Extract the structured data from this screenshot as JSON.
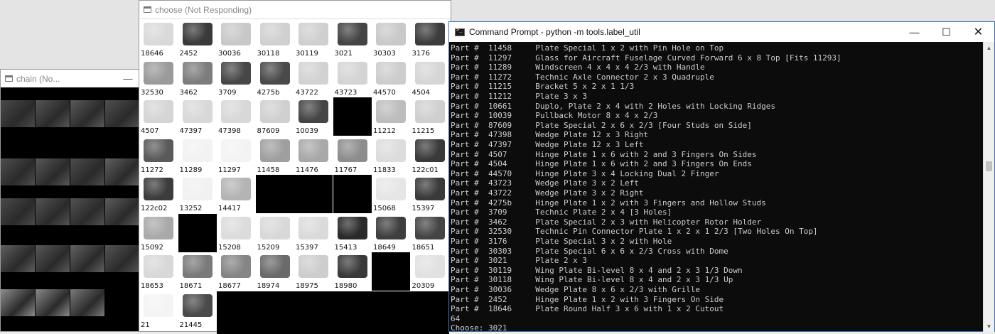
{
  "chain_window": {
    "title": "chain (No...",
    "minimize_glyph": "—",
    "thumbnails": [
      {
        "tone": "#4a4a4a"
      },
      {
        "tone": "#555"
      },
      {
        "tone": "#5a5a5a"
      },
      {
        "tone": "#505050"
      },
      {
        "tone": "#4e4e4e"
      },
      {
        "tone": "#585858"
      },
      {
        "tone": "#4c4c4c"
      },
      {
        "tone": "#606060"
      },
      {
        "tone": "#4a4a4a"
      },
      {
        "tone": "#545454"
      },
      {
        "tone": "#525252"
      },
      {
        "tone": "#5c5c5c"
      },
      {
        "tone": "#5f5f5f"
      },
      {
        "tone": "#585858"
      },
      {
        "tone": "#626262"
      },
      {
        "tone": "#545454"
      },
      {
        "tone": "#8e8e8e"
      },
      {
        "tone": "#8a8a8a"
      },
      {
        "tone": "#7a7a7a"
      }
    ]
  },
  "choose_window": {
    "title": "choose (Not Responding)",
    "parts": [
      {
        "label": "18646",
        "color": "#d9d9d9"
      },
      {
        "label": "2452",
        "color": "#3a3a3a"
      },
      {
        "label": "30036",
        "color": "#c8c8c8"
      },
      {
        "label": "30118",
        "color": "#d0d0d0"
      },
      {
        "label": "30119",
        "color": "#cfcfcf"
      },
      {
        "label": "3021",
        "color": "#444"
      },
      {
        "label": "30303",
        "color": "#c9c9c9"
      },
      {
        "label": "3176",
        "color": "#3c3c3c"
      },
      {
        "label": "32530",
        "color": "#9a9a9a"
      },
      {
        "label": "3462",
        "color": "#7d7d7d"
      },
      {
        "label": "3709",
        "color": "#474747"
      },
      {
        "label": "4275b",
        "color": "#4a4a4a"
      },
      {
        "label": "43722",
        "color": "#d2d2d2"
      },
      {
        "label": "43723",
        "color": "#d4d4d4"
      },
      {
        "label": "44570",
        "color": "#cdcdcd"
      },
      {
        "label": "4504",
        "color": "#d6d6d6"
      },
      {
        "label": "4507",
        "color": "#d5d5d5"
      },
      {
        "label": "47397",
        "color": "#d8d8d8"
      },
      {
        "label": "47398",
        "color": "#d8d8d8"
      },
      {
        "label": "87609",
        "color": "#d0d0d0"
      },
      {
        "label": "10039",
        "color": "#454545"
      },
      {
        "label": "",
        "color": "#000000"
      },
      {
        "label": "11212",
        "color": "#bdbdbd"
      },
      {
        "label": "11215",
        "color": "#cfcfcf"
      },
      {
        "label": "11272",
        "color": "#5a5a5a"
      },
      {
        "label": "11289",
        "color": "#f2f2f2"
      },
      {
        "label": "11297",
        "color": "#f3f3f3"
      },
      {
        "label": "11458",
        "color": "#9f9f9f"
      },
      {
        "label": "11476",
        "color": "#a8a8a8"
      },
      {
        "label": "11767",
        "color": "#8d8d8d"
      },
      {
        "label": "11833",
        "color": "#dcdcdc"
      },
      {
        "label": "122c01",
        "color": "#3a3a3a"
      },
      {
        "label": "122c02",
        "color": "#3c3c3c"
      },
      {
        "label": "13252",
        "color": "#f1f1f1"
      },
      {
        "label": "14417",
        "color": "#b4b4b4"
      },
      {
        "label": "",
        "color": "#000000"
      },
      {
        "label": "",
        "color": "#000000"
      },
      {
        "label": "",
        "color": "#000000"
      },
      {
        "label": "15068",
        "color": "#e6e6e6"
      },
      {
        "label": "15397",
        "color": "#3a3a3a"
      },
      {
        "label": "15092",
        "color": "#a9a9a9"
      },
      {
        "label": "",
        "color": "#000000"
      },
      {
        "label": "15208",
        "color": "#dcdcdc"
      },
      {
        "label": "15209",
        "color": "#d8d8d8"
      },
      {
        "label": "15397",
        "color": "#dadada"
      },
      {
        "label": "15413",
        "color": "#2a2a2a"
      },
      {
        "label": "18649",
        "color": "#3e3e3e"
      },
      {
        "label": "18651",
        "color": "#444"
      },
      {
        "label": "18653",
        "color": "#d8d8d8"
      },
      {
        "label": "18671",
        "color": "#7a7a7a"
      },
      {
        "label": "18677",
        "color": "#858585"
      },
      {
        "label": "18974",
        "color": "#6a6a6a"
      },
      {
        "label": "18975",
        "color": "#cdcdcd"
      },
      {
        "label": "18980",
        "color": "#3a3a3a"
      },
      {
        "label": "",
        "color": "#000000"
      },
      {
        "label": "20309",
        "color": "#e1e1e1"
      },
      {
        "label": "21",
        "color": "#f4f4f4"
      },
      {
        "label": "21445",
        "color": "#4a4a4a"
      }
    ]
  },
  "cmd_window": {
    "title": "Command Prompt - python  -m tools.label_util",
    "minimize": "—",
    "maximize": "☐",
    "close": "✕",
    "lines": [
      "Part #  11458     Plate Special 1 x 2 with Pin Hole on Top",
      "Part #  11297     Glass for Aircraft Fuselage Curved Forward 6 x 8 Top [Fits 11293]",
      "Part #  11289     Windscreen 4 x 4 x 4 2/3 with Handle",
      "Part #  11272     Technic Axle Connector 2 x 3 Quadruple",
      "Part #  11215     Bracket 5 x 2 x 1 1/3",
      "Part #  11212     Plate 3 x 3",
      "Part #  10661     Duplo, Plate 2 x 4 with 2 Holes with Locking Ridges",
      "Part #  10039     Pullback Motor 8 x 4 x 2/3",
      "Part #  87609     Plate Special 2 x 6 x 2/3 [Four Studs on Side]",
      "Part #  47398     Wedge Plate 12 x 3 Right",
      "Part #  47397     Wedge Plate 12 x 3 Left",
      "Part #  4507      Hinge Plate 1 x 6 with 2 and 3 Fingers On Sides",
      "Part #  4504      Hinge Plate 1 x 6 with 2 and 3 Fingers On Ends",
      "Part #  44570     Hinge Plate 3 x 4 Locking Dual 2 Finger",
      "Part #  43723     Wedge Plate 3 x 2 Left",
      "Part #  43722     Wedge Plate 3 x 2 Right",
      "Part #  4275b     Hinge Plate 1 x 2 with 3 Fingers and Hollow Studs",
      "Part #  3709      Technic Plate 2 x 4 [3 Holes]",
      "Part #  3462      Plate Special 2 x 3 with Helicopter Rotor Holder",
      "Part #  32530     Technic Pin Connector Plate 1 x 2 x 1 2/3 [Two Holes On Top]",
      "Part #  3176      Plate Special 3 x 2 with Hole",
      "Part #  30303     Plate Special 6 x 6 x 2/3 Cross with Dome",
      "Part #  3021      Plate 2 x 3",
      "Part #  30119     Wing Plate Bi-level 8 x 4 and 2 x 3 1/3 Down",
      "Part #  30118     Wing Plate Bi-level 8 x 4 and 2 x 3 1/3 Up",
      "Part #  30036     Wedge Plate 8 x 6 x 2/3 with Grille",
      "Part #  2452      Hinge Plate 1 x 2 with 3 Fingers On Side",
      "Part #  18646     Plate Round Half 3 x 6 with 1 x 2 Cutout",
      "64",
      "Choose: 3021"
    ],
    "scroll_position": 0.42
  }
}
